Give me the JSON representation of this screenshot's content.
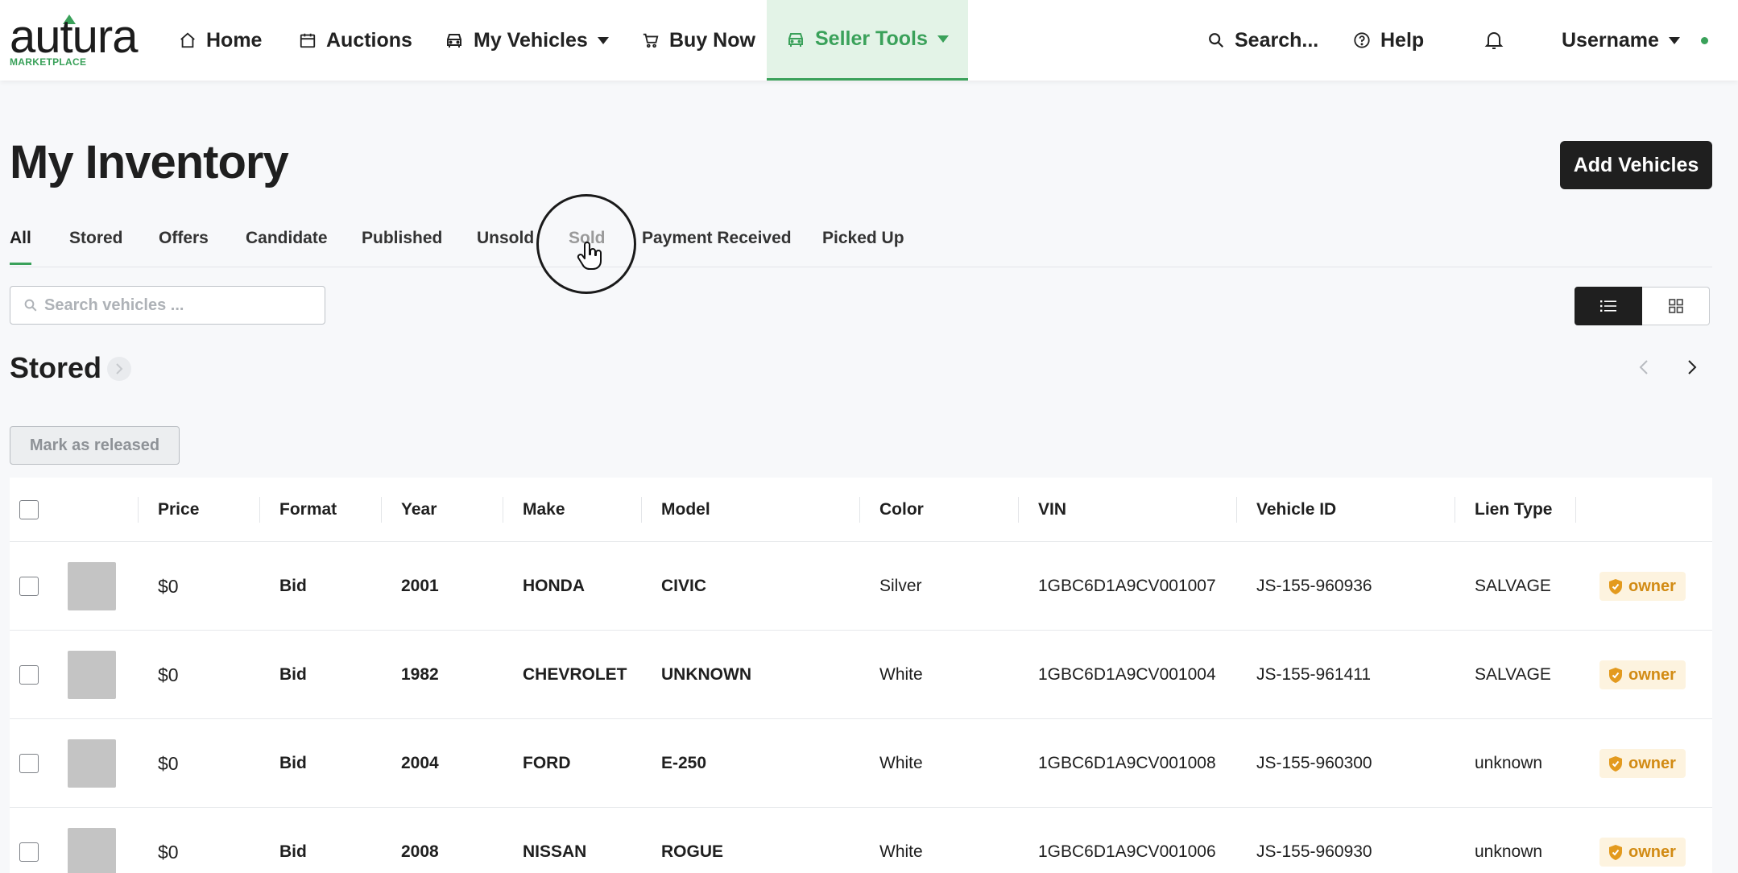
{
  "brand": {
    "logo_text": "autura",
    "logo_sub": "MARKETPLACE",
    "accent": "#3aa15a"
  },
  "nav": {
    "home": "Home",
    "auctions": "Auctions",
    "my_vehicles": "My Vehicles",
    "buy_now": "Buy Now",
    "seller_tools": "Seller Tools",
    "search": "Search...",
    "help": "Help",
    "username": "Username"
  },
  "page": {
    "title": "My Inventory",
    "add_button": "Add Vehicles"
  },
  "tabs": [
    "All",
    "Stored",
    "Offers",
    "Candidate",
    "Published",
    "Unsold",
    "Sold",
    "Payment Received",
    "Picked Up"
  ],
  "active_tab": "All",
  "hovered_tab": "Sold",
  "search": {
    "placeholder": "Search vehicles ...",
    "value": ""
  },
  "view_toggle": {
    "selected": "list",
    "icons": [
      "list-icon",
      "grid-icon"
    ]
  },
  "section": {
    "title": "Stored",
    "release_button": "Mark as released"
  },
  "table": {
    "columns": [
      "Price",
      "Format",
      "Year",
      "Make",
      "Model",
      "Color",
      "VIN",
      "Vehicle ID",
      "Lien Type"
    ],
    "rows": [
      {
        "price": "$0",
        "format": "Bid",
        "year": "2001",
        "make": "HONDA",
        "model": "CIVIC",
        "color": "Silver",
        "vin": "1GBC6D1A9CV001007",
        "vehicle_id": "JS-155-960936",
        "lien_type": "SALVAGE",
        "badge": "owner"
      },
      {
        "price": "$0",
        "format": "Bid",
        "year": "1982",
        "make": "CHEVROLET",
        "model": "UNKNOWN",
        "color": "White",
        "vin": "1GBC6D1A9CV001004",
        "vehicle_id": "JS-155-961411",
        "lien_type": "SALVAGE",
        "badge": "owner"
      },
      {
        "price": "$0",
        "format": "Bid",
        "year": "2004",
        "make": "FORD",
        "model": "E-250",
        "color": "White",
        "vin": "1GBC6D1A9CV001008",
        "vehicle_id": "JS-155-960300",
        "lien_type": "unknown",
        "badge": "owner"
      },
      {
        "price": "$0",
        "format": "Bid",
        "year": "2008",
        "make": "NISSAN",
        "model": "ROGUE",
        "color": "White",
        "vin": "1GBC6D1A9CV001006",
        "vehicle_id": "JS-155-960930",
        "lien_type": "unknown",
        "badge": "owner"
      }
    ]
  }
}
